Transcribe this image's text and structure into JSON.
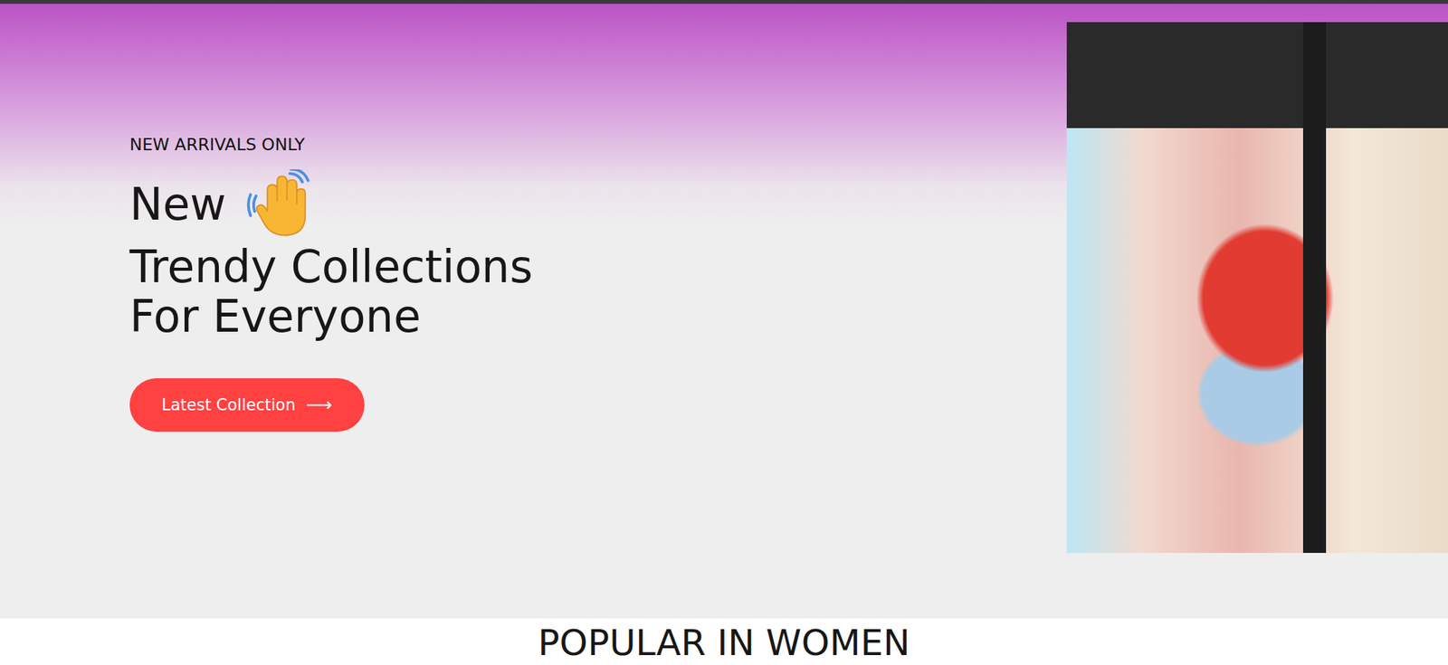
{
  "hero": {
    "tag": "NEW ARRIVALS ONLY",
    "headline_first": "New",
    "headline_lines": [
      "Trendy Collections",
      "For Everyone"
    ],
    "button": {
      "label": "Latest Collection",
      "arrow": "⟶"
    }
  },
  "section": {
    "title": "POPULAR IN WOMEN"
  }
}
